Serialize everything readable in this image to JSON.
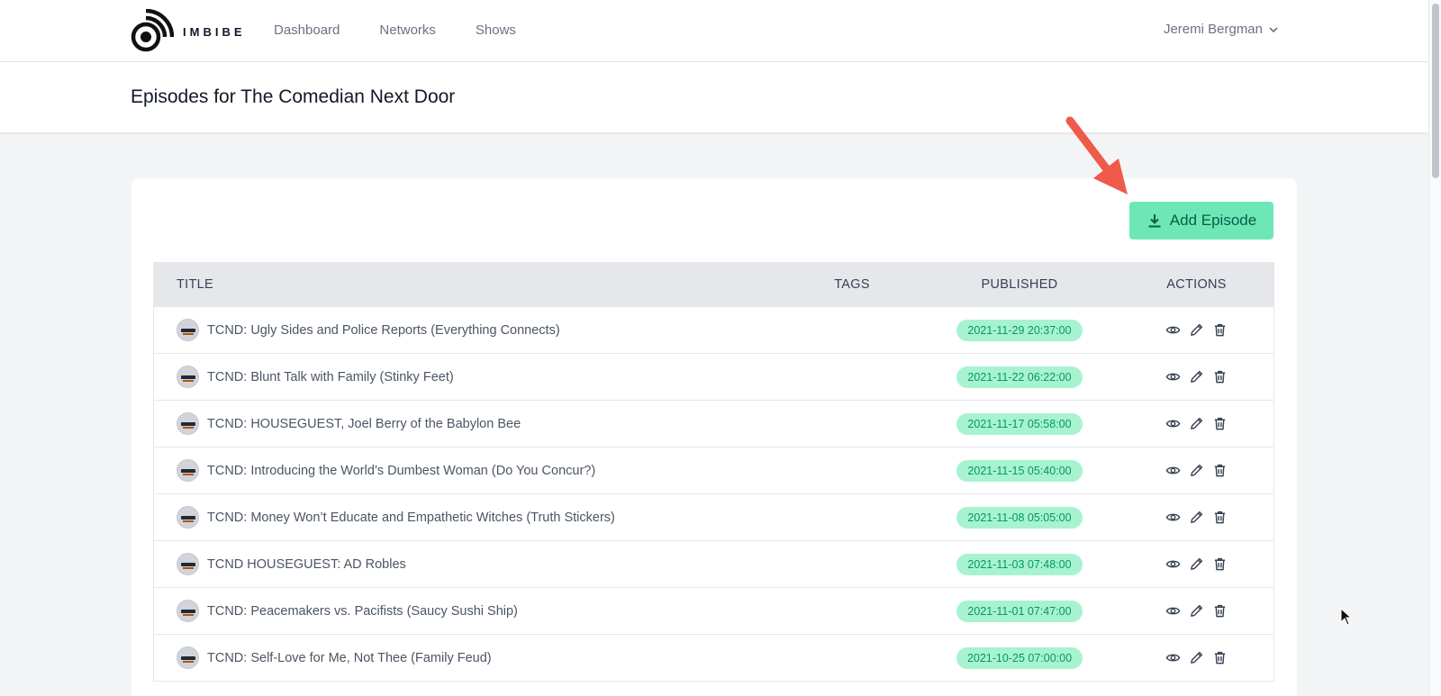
{
  "brand": {
    "name": "IMBIBE"
  },
  "nav": {
    "links": [
      {
        "label": "Dashboard"
      },
      {
        "label": "Networks"
      },
      {
        "label": "Shows"
      }
    ],
    "user": "Jeremi Bergman"
  },
  "page": {
    "title": "Episodes for The Comedian Next Door"
  },
  "toolbar": {
    "add_label": "Add Episode"
  },
  "table": {
    "headers": {
      "title": "Title",
      "tags": "Tags",
      "published": "Published",
      "actions": "Actions"
    },
    "rows": [
      {
        "title": "TCND: Ugly Sides and Police Reports (Everything Connects)",
        "published": "2021-11-29 20:37:00"
      },
      {
        "title": "TCND: Blunt Talk with Family (Stinky Feet)",
        "published": "2021-11-22 06:22:00"
      },
      {
        "title": "TCND: HOUSEGUEST, Joel Berry of the Babylon Bee",
        "published": "2021-11-17 05:58:00"
      },
      {
        "title": "TCND: Introducing the World’s Dumbest Woman (Do You Concur?)",
        "published": "2021-11-15 05:40:00"
      },
      {
        "title": "TCND: Money Won’t Educate and Empathetic Witches (Truth Stickers)",
        "published": "2021-11-08 05:05:00"
      },
      {
        "title": "TCND HOUSEGUEST: AD Robles",
        "published": "2021-11-03 07:48:00"
      },
      {
        "title": "TCND: Peacemakers vs. Pacifists (Saucy Sushi Ship)",
        "published": "2021-11-01 07:47:00"
      },
      {
        "title": "TCND: Self-Love for Me, Not Thee (Family Feud)",
        "published": "2021-10-25 07:00:00"
      }
    ]
  },
  "colors": {
    "accent": "#6ee7b7",
    "badge_bg": "#a7f3d0",
    "badge_text": "#059669",
    "arrow": "#ef5a4a"
  }
}
